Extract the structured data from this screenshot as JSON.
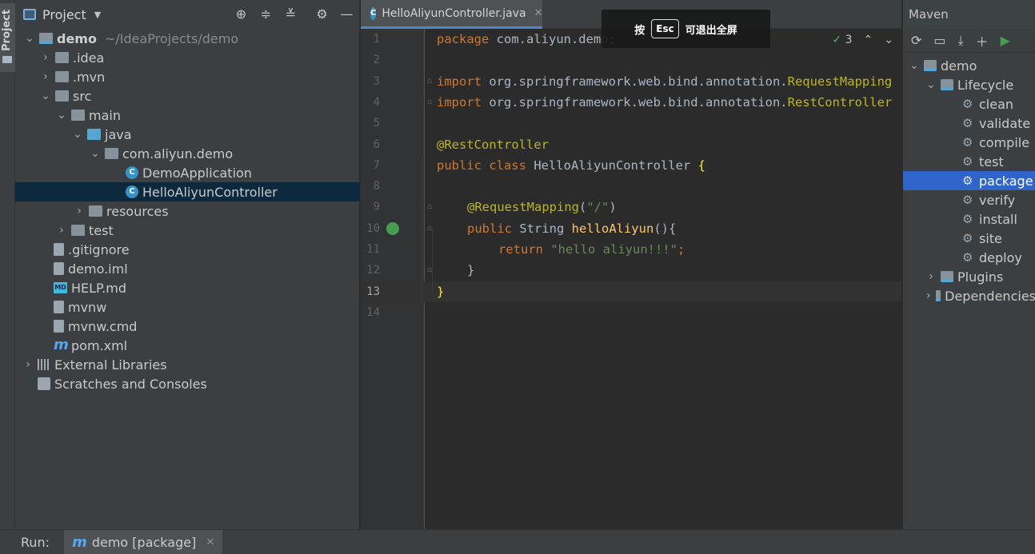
{
  "left_strip": {
    "tab_label": "Project"
  },
  "project_panel": {
    "title": "Project",
    "tools": [
      "locate-icon",
      "expand-all-icon",
      "collapse-all-icon",
      "settings-icon",
      "minimize-icon"
    ],
    "tree": [
      {
        "label": "demo",
        "extra": "~/IdeaProjects/demo",
        "icon": "module-folder-icon",
        "expanded": true
      },
      {
        "label": ".idea",
        "icon": "folder-icon",
        "expanded": false
      },
      {
        "label": ".mvn",
        "icon": "folder-icon",
        "expanded": false
      },
      {
        "label": "src",
        "icon": "folder-icon",
        "expanded": true
      },
      {
        "label": "main",
        "icon": "folder-icon",
        "expanded": true
      },
      {
        "label": "java",
        "icon": "source-folder-icon",
        "expanded": true
      },
      {
        "label": "com.aliyun.demo",
        "icon": "package-icon",
        "expanded": true
      },
      {
        "label": "DemoApplication",
        "icon": "spring-class-icon"
      },
      {
        "label": "HelloAliyunController",
        "icon": "class-icon",
        "selected": true
      },
      {
        "label": "resources",
        "icon": "resources-folder-icon",
        "expanded": false
      },
      {
        "label": "test",
        "icon": "folder-icon",
        "expanded": false
      },
      {
        "label": ".gitignore",
        "icon": "file-icon"
      },
      {
        "label": "demo.iml",
        "icon": "file-icon"
      },
      {
        "label": "HELP.md",
        "icon": "markdown-icon"
      },
      {
        "label": "mvnw",
        "icon": "script-icon"
      },
      {
        "label": "mvnw.cmd",
        "icon": "file-icon"
      },
      {
        "label": "pom.xml",
        "icon": "maven-icon"
      },
      {
        "label": "External Libraries",
        "icon": "libraries-icon",
        "expanded": false
      },
      {
        "label": "Scratches and Consoles",
        "icon": "scratches-icon"
      }
    ]
  },
  "editor": {
    "tab_label": "HelloAliyunController.java",
    "inspection_count": "3",
    "current_line": 13,
    "lines": [
      "1",
      "2",
      "3",
      "4",
      "5",
      "6",
      "7",
      "8",
      "9",
      "10",
      "11",
      "12",
      "13",
      "14"
    ],
    "code": {
      "l1_kw": "package",
      "l1_rest": " com.aliyun.demo;",
      "l3_kw": "import",
      "l3_rest": " org.springframework.web.bind.annotation.",
      "l3_cls": "RequestMapping",
      "l4_kw": "import",
      "l4_rest": " org.springframework.web.bind.annotation.",
      "l4_cls": "RestController",
      "l6_ann": "@RestController",
      "l7_kw": "public class",
      "l7_rest": " HelloAliyunController ",
      "l7_brace": "{",
      "l9_ann": "@RequestMapping",
      "l9_rest": "(",
      "l9_str": "\"/\"",
      "l9_close": ")",
      "l10_kw": "public",
      "l10_type": " String ",
      "l10_fn": "helloAliyun",
      "l10_rest": "(){",
      "l11_kw": "return",
      "l11_str": " \"hello aliyun!!!\"",
      "l11_semi": ";",
      "l12": "}",
      "l13": "}"
    }
  },
  "overlay": {
    "prefix": "按",
    "key": "Esc",
    "suffix": "可退出全屏"
  },
  "maven_panel": {
    "title": "Maven",
    "tools": [
      "reload-icon",
      "add-folder-icon",
      "download-icon",
      "plus-icon",
      "run-icon"
    ],
    "tree": [
      {
        "label": "demo",
        "level": 0,
        "expanded": true,
        "icon": "maven-project-icon"
      },
      {
        "label": "Lifecycle",
        "level": 1,
        "expanded": true,
        "icon": "lifecycle-icon"
      },
      {
        "label": "clean",
        "level": 2
      },
      {
        "label": "validate",
        "level": 2
      },
      {
        "label": "compile",
        "level": 2
      },
      {
        "label": "test",
        "level": 2
      },
      {
        "label": "package",
        "level": 2,
        "selected": true
      },
      {
        "label": "verify",
        "level": 2
      },
      {
        "label": "install",
        "level": 2
      },
      {
        "label": "site",
        "level": 2
      },
      {
        "label": "deploy",
        "level": 2
      },
      {
        "label": "Plugins",
        "level": 1,
        "expanded": false,
        "icon": "plugins-icon"
      },
      {
        "label": "Dependencies",
        "level": 1,
        "expanded": false,
        "icon": "dependencies-icon"
      }
    ]
  },
  "run_bar": {
    "label": "Run:",
    "tab_label": "demo [package]"
  },
  "colors": {
    "selection": "#0d293e",
    "maven_selection": "#2f65ca",
    "keyword": "#cc7832",
    "annotation": "#bbb529",
    "string": "#6a8759",
    "function": "#ffc66d"
  }
}
